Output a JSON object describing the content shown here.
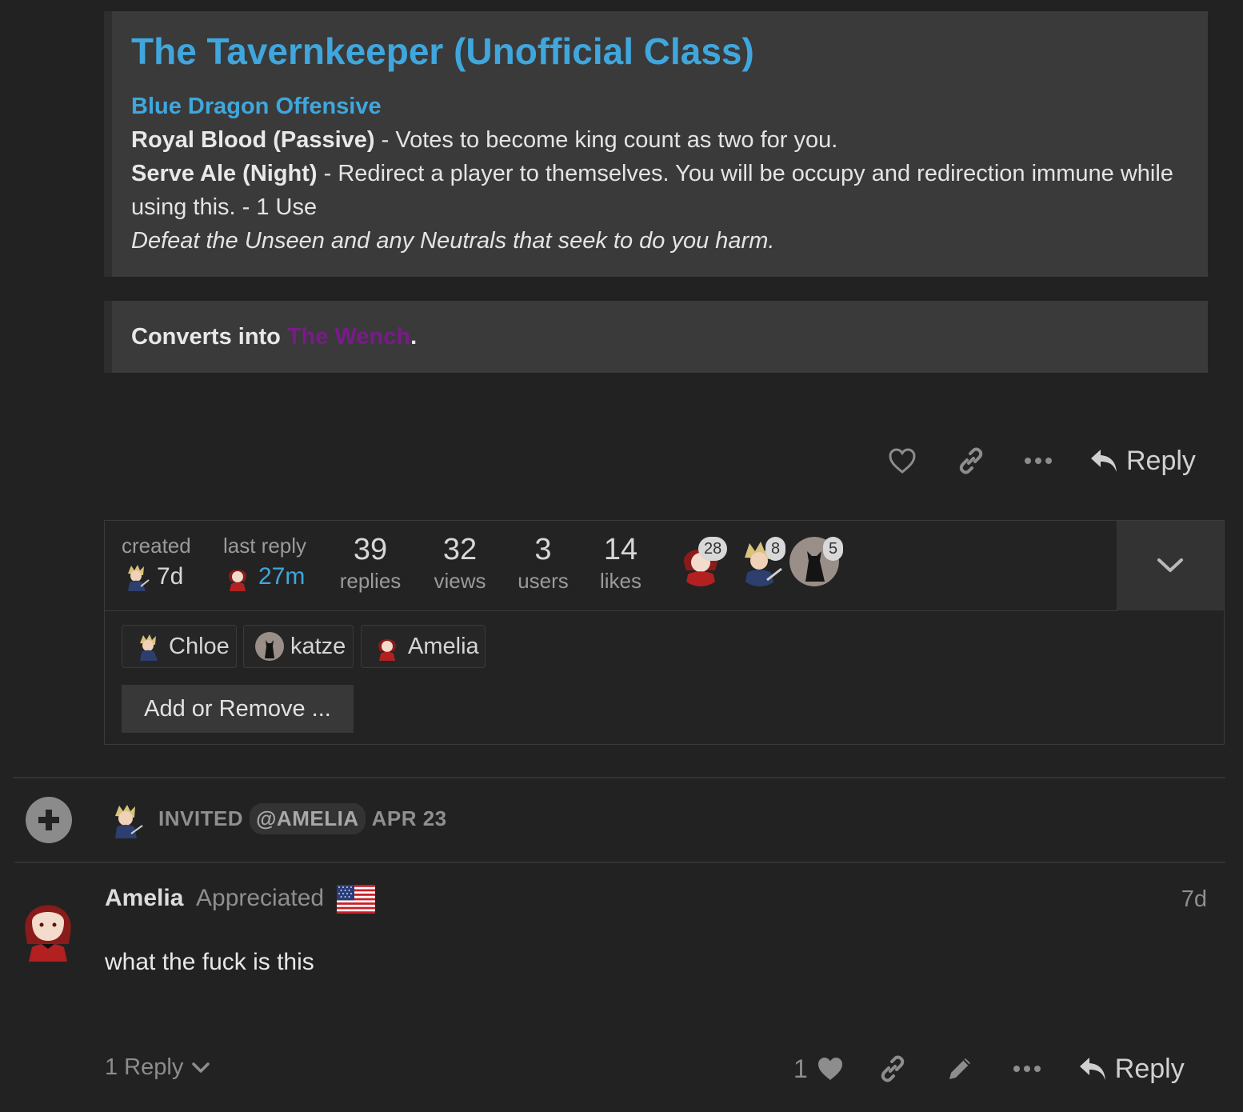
{
  "class_card": {
    "title": "The Tavernkeeper (Unofficial Class)",
    "team": "Blue Dragon Offensive",
    "abilities": [
      {
        "name": "Royal Blood (Passive)",
        "text": " - Votes to become king count as two for you."
      },
      {
        "name": "Serve Ale (Night)",
        "text": " - Redirect a player to themselves. You will be occupy and redirection immune while using this. - 1 Use"
      }
    ],
    "flavor": "Defeat the Unseen and any Neutrals that seek to do you harm.",
    "converts_prefix": "Converts into ",
    "converts_target": "The Wench",
    "converts_suffix": ".",
    "converts_target_color": "#7a1a8a"
  },
  "post_actions": {
    "reply_label": "Reply"
  },
  "topic_map": {
    "created_label": "created",
    "created_value": "7d",
    "last_reply_label": "last reply",
    "last_reply_value": "27m",
    "stats": [
      {
        "num": "39",
        "label": "replies"
      },
      {
        "num": "32",
        "label": "views"
      },
      {
        "num": "3",
        "label": "users"
      },
      {
        "num": "14",
        "label": "likes"
      }
    ],
    "participants": [
      {
        "name": "amelia",
        "count": "28"
      },
      {
        "name": "chloe",
        "count": "8"
      },
      {
        "name": "katze",
        "count": "5"
      }
    ],
    "allowed_users": [
      "Chloe",
      "katze",
      "Amelia"
    ],
    "add_remove_label": "Add or Remove ..."
  },
  "small_action": {
    "action": "INVITED",
    "mention": "@AMELIA",
    "date": "APR 23"
  },
  "post": {
    "username": "Amelia",
    "user_title": "Appreciated",
    "age": "7d",
    "body": "what the fuck is this",
    "replies_label": "1 Reply",
    "like_count": "1",
    "reply_label": "Reply"
  },
  "colors": {
    "background": "#222222",
    "link": "#3fa7dd",
    "accent_blue": "#3fa7dd"
  }
}
